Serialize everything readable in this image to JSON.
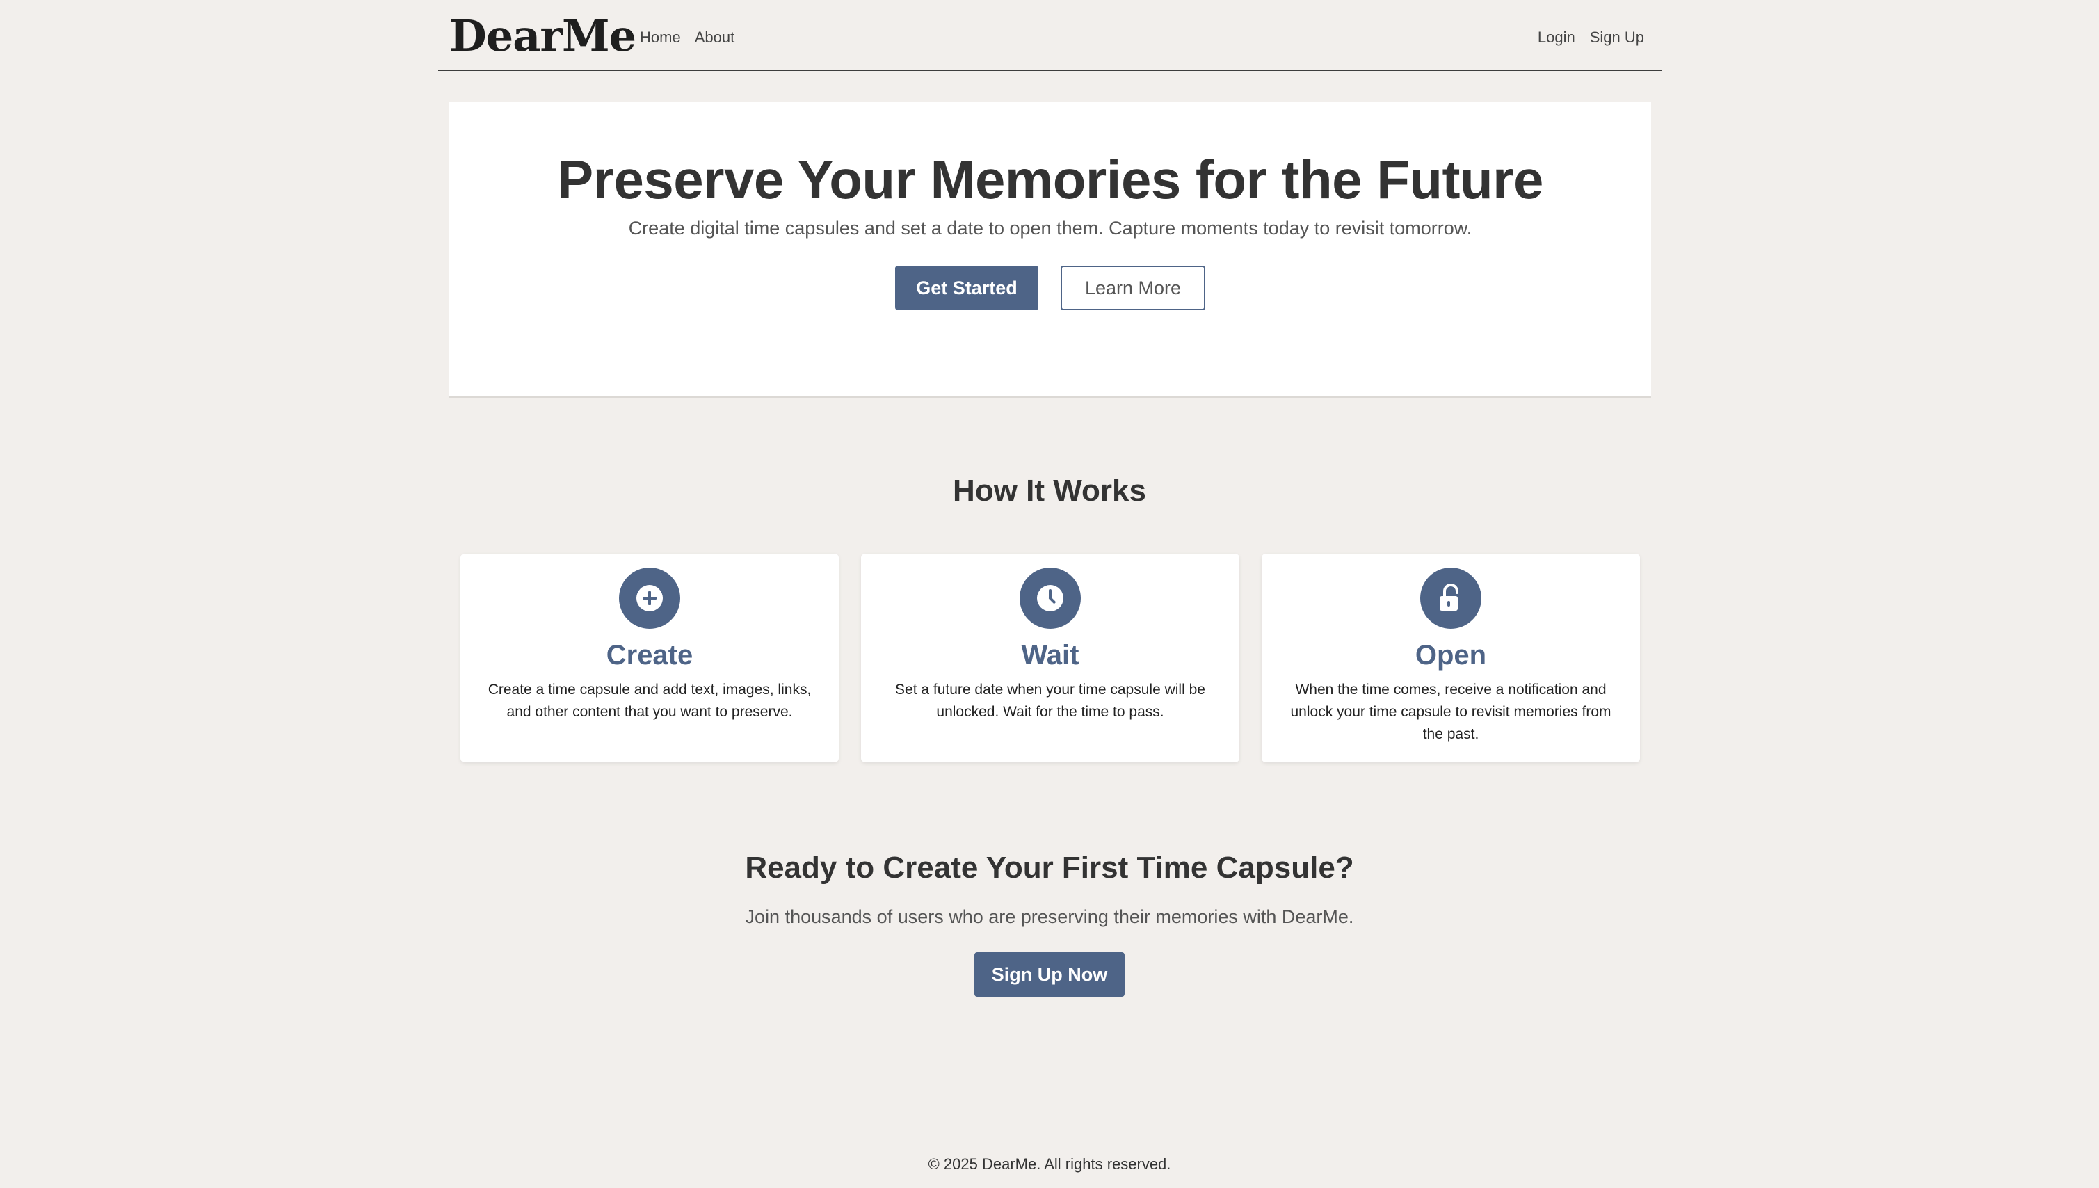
{
  "nav": {
    "brand": "DearMe",
    "left_links": [
      "Home",
      "About"
    ],
    "right_links": [
      "Login",
      "Sign Up"
    ]
  },
  "hero": {
    "title": "Preserve Your Memories for the Future",
    "subtitle": "Create digital time capsules and set a date to open them. Capture moments today to revisit tomorrow.",
    "primary_button": "Get Started",
    "secondary_button": "Learn More"
  },
  "how_it_works": {
    "title": "How It Works",
    "cards": [
      {
        "icon": "plus-circle-icon",
        "title": "Create",
        "text": "Create a time capsule and add text, images, links, and other content that you want to preserve."
      },
      {
        "icon": "clock-icon",
        "title": "Wait",
        "text": "Set a future date when your time capsule will be unlocked. Wait for the time to pass."
      },
      {
        "icon": "unlock-icon",
        "title": "Open",
        "text": "When the time comes, receive a notification and unlock your time capsule to revisit memories from the past."
      }
    ]
  },
  "cta": {
    "title": "Ready to Create Your First Time Capsule?",
    "subtitle": "Join thousands of users who are preserving their memories with DearMe.",
    "button": "Sign Up Now"
  },
  "footer": {
    "text": "© 2025 DearMe. All rights reserved."
  },
  "colors": {
    "background": "#f2efec",
    "accent": "#4e6487",
    "text": "#333333",
    "card": "#ffffff"
  }
}
